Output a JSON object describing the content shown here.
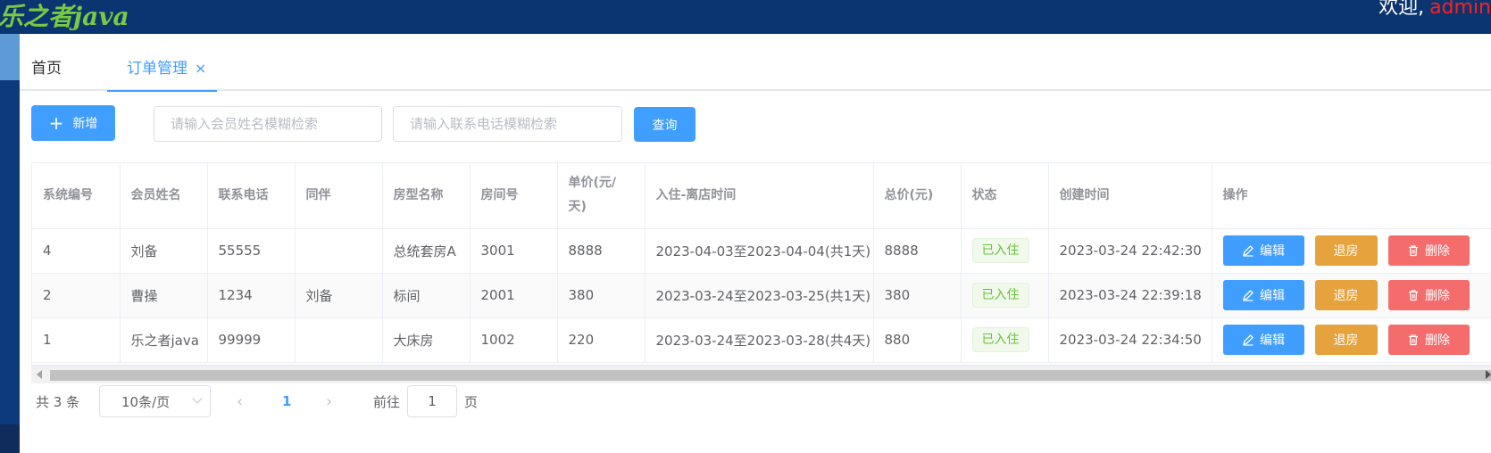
{
  "header": {
    "logo_text": "乐之者java",
    "welcome_text": "欢迎,",
    "username": "admin"
  },
  "tabs": [
    {
      "label": "首页"
    },
    {
      "label": "订单管理",
      "close": "×"
    }
  ],
  "toolbar": {
    "add_icon": "+",
    "add_label": "新增",
    "name_placeholder": "请输入会员姓名模糊检索",
    "phone_placeholder": "请输入联系电话模糊检索",
    "query_label": "查询"
  },
  "table": {
    "columns": [
      "系统编号",
      "会员姓名",
      "联系电话",
      "同伴",
      "房型名称",
      "房间号",
      "单价(元/天)",
      "入住-离店时间",
      "总价(元)",
      "状态",
      "创建时间",
      "操作"
    ],
    "rows": [
      {
        "id": "4",
        "member": "刘备",
        "phone": "55555",
        "companion": "",
        "room_type": "总统套房A",
        "room_no": "3001",
        "unit_price": "8888",
        "stay": "2023-04-03至2023-04-04(共1天)",
        "total": "8888",
        "status": "已入住",
        "created": "2023-03-24 22:42:30"
      },
      {
        "id": "2",
        "member": "曹操",
        "phone": "1234",
        "companion": "刘备",
        "room_type": "标间",
        "room_no": "2001",
        "unit_price": "380",
        "stay": "2023-03-24至2023-03-25(共1天)",
        "total": "380",
        "status": "已入住",
        "created": "2023-03-24 22:39:18"
      },
      {
        "id": "1",
        "member": "乐之者java",
        "phone": "99999",
        "companion": "",
        "room_type": "大床房",
        "room_no": "1002",
        "unit_price": "220",
        "stay": "2023-03-24至2023-03-28(共4天)",
        "total": "880",
        "status": "已入住",
        "created": "2023-03-24 22:34:50"
      }
    ],
    "actions": {
      "edit": "编辑",
      "checkout": "退房",
      "delete": "删除"
    }
  },
  "pagination": {
    "total_text": "共 3 条",
    "page_size": "10条/页",
    "current_page": "1",
    "goto_label": "前往",
    "goto_value": "1",
    "page_unit": "页"
  },
  "colors": {
    "header_bg": "#0b3570",
    "primary": "#409eff",
    "warning": "#e6a23c",
    "danger": "#f56c6c",
    "success": "#67c23a"
  }
}
